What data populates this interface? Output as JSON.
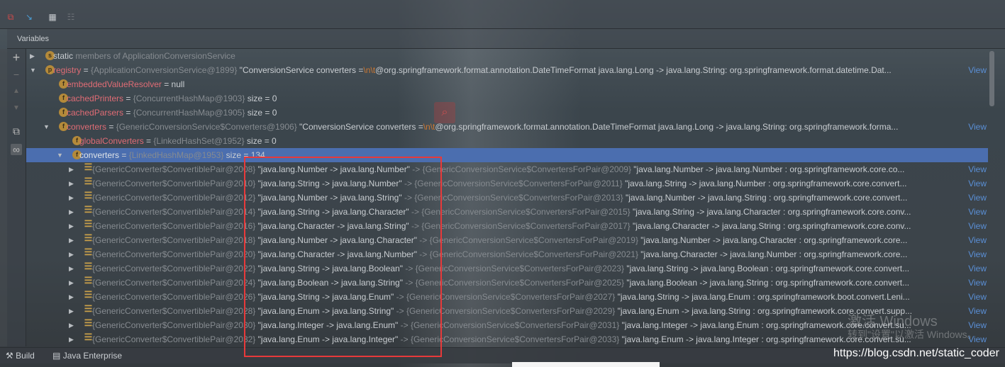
{
  "panel": {
    "title": "Variables"
  },
  "toolbar": {
    "icons": [
      "restore-layout-icon",
      "step-cursor-icon",
      "evaluate-icon",
      "settings-grid-icon"
    ]
  },
  "gutter": {
    "icons": [
      "add-icon",
      "remove-icon",
      "up-icon",
      "down-icon",
      "copy-icon",
      "watches-icon"
    ]
  },
  "view_label": "View",
  "rows": [
    {
      "level": 0,
      "expand": "collapsed",
      "icon": "s",
      "name": "static",
      "name_plain": true,
      "value": "members of ApplicationConversionService",
      "text": "",
      "view": false
    },
    {
      "level": 0,
      "expand": "expanded",
      "icon": "p",
      "name": "registry",
      "value": "{ApplicationConversionService@1899}",
      "text_pre": " \"ConversionService converters =",
      "esc": "\\n\\t",
      "text": "@org.springframework.format.annotation.DateTimeFormat java.lang.Long -> java.lang.String: org.springframework.format.datetime.Dat...",
      "view": true
    },
    {
      "level": 1,
      "expand": "none",
      "icon": "f",
      "name": "embeddedValueResolver",
      "value": "",
      "text": " = null",
      "view": false
    },
    {
      "level": 1,
      "expand": "none",
      "icon": "f",
      "name": "cachedPrinters",
      "value": "{ConcurrentHashMap@1903}",
      "text": "  size = 0",
      "view": false
    },
    {
      "level": 1,
      "expand": "none",
      "icon": "f",
      "name": "cachedParsers",
      "value": "{ConcurrentHashMap@1905}",
      "text": "  size = 0",
      "view": false
    },
    {
      "level": 1,
      "expand": "expanded",
      "icon": "f",
      "name": "converters",
      "value": "{GenericConversionService$Converters@1906}",
      "text_pre": " \"ConversionService converters =",
      "esc": "\\n\\t",
      "text": "@org.springframework.format.annotation.DateTimeFormat java.lang.Long -> java.lang.String: org.springframework.forma...",
      "view": true
    },
    {
      "level": 2,
      "expand": "none",
      "icon": "f",
      "name": "globalConverters",
      "value": "{LinkedHashSet@1952}",
      "text": "  size = 0",
      "view": false
    },
    {
      "level": 2,
      "expand": "expanded",
      "icon": "f",
      "name": "converters",
      "value": "{LinkedHashMap@1953}",
      "text": "  size = 134",
      "view": false,
      "selected": true
    },
    {
      "level": 3,
      "expand": "collapsed",
      "icon": "list",
      "key": "{GenericConverter$ConvertiblePair@2008}",
      "key_str": "\"java.lang.Number -> java.lang.Number\"",
      "value": "{GenericConversionService$ConvertersForPair@2009}",
      "text": " \"java.lang.Number -> java.lang.Number : org.springframework.core.co...",
      "view": true
    },
    {
      "level": 3,
      "expand": "collapsed",
      "icon": "list",
      "key": "{GenericConverter$ConvertiblePair@2010}",
      "key_str": "\"java.lang.String -> java.lang.Number\"",
      "value": "{GenericConversionService$ConvertersForPair@2011}",
      "text": " \"java.lang.String -> java.lang.Number : org.springframework.core.convert...",
      "view": true
    },
    {
      "level": 3,
      "expand": "collapsed",
      "icon": "list",
      "key": "{GenericConverter$ConvertiblePair@2012}",
      "key_str": "\"java.lang.Number -> java.lang.String\"",
      "value": "{GenericConversionService$ConvertersForPair@2013}",
      "text": " \"java.lang.Number -> java.lang.String : org.springframework.core.convert...",
      "view": true
    },
    {
      "level": 3,
      "expand": "collapsed",
      "icon": "list",
      "key": "{GenericConverter$ConvertiblePair@2014}",
      "key_str": "\"java.lang.String -> java.lang.Character\"",
      "value": "{GenericConversionService$ConvertersForPair@2015}",
      "text": " \"java.lang.String -> java.lang.Character : org.springframework.core.conv...",
      "view": true
    },
    {
      "level": 3,
      "expand": "collapsed",
      "icon": "list",
      "key": "{GenericConverter$ConvertiblePair@2016}",
      "key_str": "\"java.lang.Character -> java.lang.String\"",
      "value": "{GenericConversionService$ConvertersForPair@2017}",
      "text": " \"java.lang.Character -> java.lang.String : org.springframework.core.conv...",
      "view": true
    },
    {
      "level": 3,
      "expand": "collapsed",
      "icon": "list",
      "key": "{GenericConverter$ConvertiblePair@2018}",
      "key_str": "\"java.lang.Number -> java.lang.Character\"",
      "value": "{GenericConversionService$ConvertersForPair@2019}",
      "text": " \"java.lang.Number -> java.lang.Character : org.springframework.core...",
      "view": true
    },
    {
      "level": 3,
      "expand": "collapsed",
      "icon": "list",
      "key": "{GenericConverter$ConvertiblePair@2020}",
      "key_str": "\"java.lang.Character -> java.lang.Number\"",
      "value": "{GenericConversionService$ConvertersForPair@2021}",
      "text": " \"java.lang.Character -> java.lang.Number : org.springframework.core...",
      "view": true
    },
    {
      "level": 3,
      "expand": "collapsed",
      "icon": "list",
      "key": "{GenericConverter$ConvertiblePair@2022}",
      "key_str": "\"java.lang.String -> java.lang.Boolean\"",
      "value": "{GenericConversionService$ConvertersForPair@2023}",
      "text": " \"java.lang.String -> java.lang.Boolean : org.springframework.core.convert...",
      "view": true
    },
    {
      "level": 3,
      "expand": "collapsed",
      "icon": "list",
      "key": "{GenericConverter$ConvertiblePair@2024}",
      "key_str": "\"java.lang.Boolean -> java.lang.String\"",
      "value": "{GenericConversionService$ConvertersForPair@2025}",
      "text": " \"java.lang.Boolean -> java.lang.String : org.springframework.core.convert...",
      "view": true
    },
    {
      "level": 3,
      "expand": "collapsed",
      "icon": "list",
      "key": "{GenericConverter$ConvertiblePair@2026}",
      "key_str": "\"java.lang.String -> java.lang.Enum\"",
      "value": "{GenericConversionService$ConvertersForPair@2027}",
      "text": " \"java.lang.String -> java.lang.Enum : org.springframework.boot.convert.Leni...",
      "view": true
    },
    {
      "level": 3,
      "expand": "collapsed",
      "icon": "list",
      "key": "{GenericConverter$ConvertiblePair@2028}",
      "key_str": "\"java.lang.Enum -> java.lang.String\"",
      "value": "{GenericConversionService$ConvertersForPair@2029}",
      "text": " \"java.lang.Enum -> java.lang.String : org.springframework.core.convert.supp...",
      "view": true
    },
    {
      "level": 3,
      "expand": "collapsed",
      "icon": "list",
      "key": "{GenericConverter$ConvertiblePair@2030}",
      "key_str": "\"java.lang.Integer -> java.lang.Enum\"",
      "value": "{GenericConversionService$ConvertersForPair@2031}",
      "text": " \"java.lang.Integer -> java.lang.Enum : org.springframework.core.convert.su...",
      "view": true
    },
    {
      "level": 3,
      "expand": "collapsed",
      "icon": "list",
      "key": "{GenericConverter$ConvertiblePair@2032}",
      "key_str": "\"java.lang.Enum -> java.lang.Integer\"",
      "value": "{GenericConversionService$ConvertersForPair@2033}",
      "text": " \"java.lang.Enum -> java.lang.Integer : org.springframework.core.convert.su...",
      "view": true
    }
  ],
  "bottom": {
    "build": "Build",
    "java_enterprise": "Java Enterprise"
  },
  "watermarks": {
    "blog": "https://blog.csdn.net/static_coder",
    "win1": "激活 Windows",
    "win2": "转到\"设置\"以激活 Windows。"
  },
  "colors": {
    "selection": "#4b6eaf",
    "field_name": "#e06c75",
    "link": "#5a8fd6",
    "highlight_box": "#e8393a"
  }
}
